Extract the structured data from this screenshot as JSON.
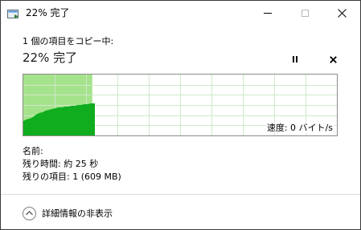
{
  "window": {
    "title": "22% 完了"
  },
  "header": {
    "subtitle": "1 個の項目をコピー中:",
    "status": "22% 完了",
    "pause_icon": "pause-icon",
    "cancel_icon": "close-icon"
  },
  "graph": {
    "progress": 0.22,
    "speed_label": "速度: 0 バイト/s",
    "colors": {
      "progress_fill": "#a5e28c",
      "speed_fill": "#10ad1f",
      "grid_line": "#cfe8cc"
    }
  },
  "details": {
    "name_label": "名前:",
    "time_remaining": "残り時間:  約 25 秒",
    "items_remaining": "残りの項目:  1 (609 MB)"
  },
  "footer": {
    "toggle_label": "詳細情報の非表示",
    "toggle_icon": "chevron-up-icon"
  }
}
